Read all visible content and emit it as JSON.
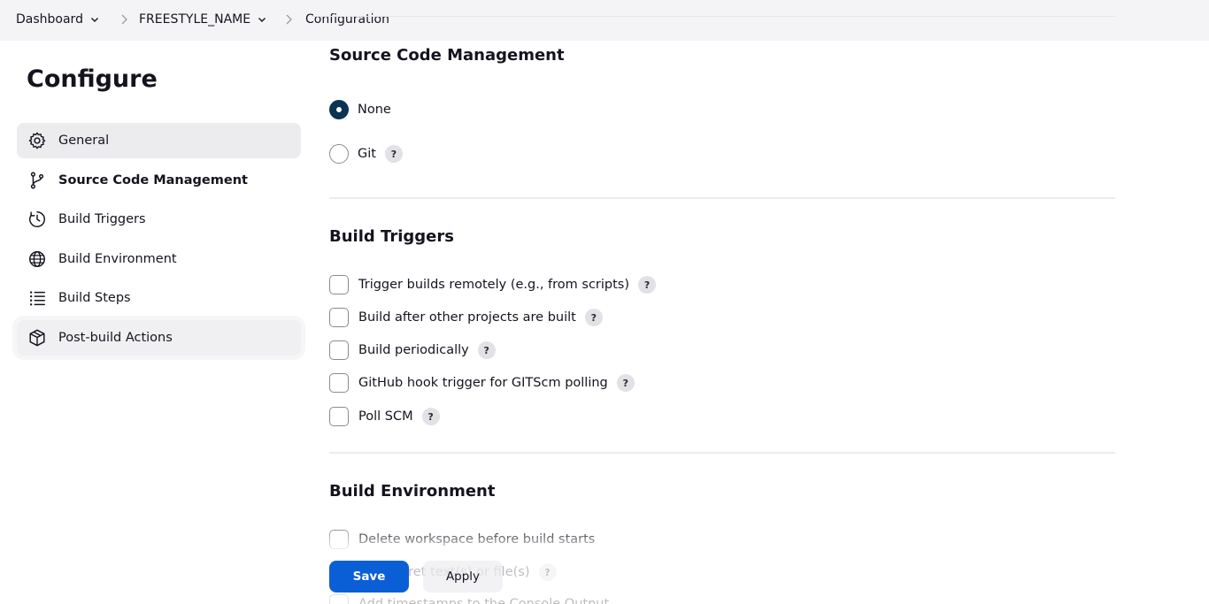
{
  "breadcrumb": {
    "items": [
      {
        "label": "Dashboard",
        "has_dropdown": true
      },
      {
        "label": "FREESTYLE_NAME",
        "has_dropdown": true
      },
      {
        "label": "Configuration",
        "has_dropdown": false
      }
    ]
  },
  "sidebar": {
    "title": "Configure",
    "items": [
      {
        "label": "General",
        "icon": "gear-icon",
        "state": "active"
      },
      {
        "label": "Source Code Management",
        "icon": "branch-icon",
        "state": "current"
      },
      {
        "label": "Build Triggers",
        "icon": "timer-icon"
      },
      {
        "label": "Build Environment",
        "icon": "globe-icon"
      },
      {
        "label": "Build Steps",
        "icon": "list-icon"
      },
      {
        "label": "Post-build Actions",
        "icon": "package-icon",
        "state": "hover"
      }
    ]
  },
  "scm": {
    "title": "Source Code Management",
    "options": [
      {
        "label": "None",
        "selected": true,
        "help": false
      },
      {
        "label": "Git",
        "selected": false,
        "help": true
      }
    ]
  },
  "triggers": {
    "title": "Build Triggers",
    "options": [
      {
        "label": "Trigger builds remotely (e.g., from scripts)",
        "checked": false,
        "help": true
      },
      {
        "label": "Build after other projects are built",
        "checked": false,
        "help": true
      },
      {
        "label": "Build periodically",
        "checked": false,
        "help": true
      },
      {
        "label": "GitHub hook trigger for GITScm polling",
        "checked": false,
        "help": true
      },
      {
        "label": "Poll SCM",
        "checked": false,
        "help": true
      }
    ]
  },
  "environment": {
    "title": "Build Environment",
    "options": [
      {
        "label": "Delete workspace before build starts",
        "checked": false,
        "help": false
      },
      {
        "label": "Use secret text(s) or file(s)",
        "checked": false,
        "help": true
      },
      {
        "label": "Add timestamps to the Console Output",
        "checked": false,
        "help": false
      }
    ]
  },
  "help_glyph": "?",
  "actions": {
    "save_label": "Save",
    "apply_label": "Apply"
  },
  "colors": {
    "primary": "#0b5fd6",
    "radio_selected": "#0b3352",
    "topbar_bg": "#f4f4f6"
  }
}
